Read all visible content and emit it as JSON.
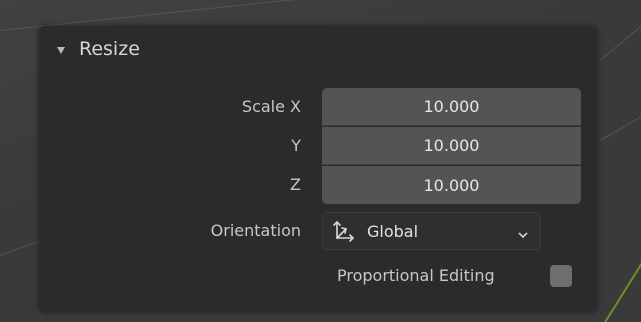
{
  "panel": {
    "title": "Resize",
    "collapse_icon": "triangle-down-icon"
  },
  "scale": {
    "label_x": "Scale X",
    "label_y": "Y",
    "label_z": "Z",
    "value_x": "10.000",
    "value_y": "10.000",
    "value_z": "10.000"
  },
  "orientation": {
    "label": "Orientation",
    "selected": "Global",
    "icon": "orientation-axes-icon",
    "dropdown_icon": "chevron-down-icon"
  },
  "proportional_editing": {
    "label": "Proportional Editing",
    "checked": false
  },
  "colors": {
    "panel_bg": "#2b2b2b",
    "field_bg": "#545454",
    "text": "#c7c7c7",
    "accent_line": "#6a8f2a"
  }
}
